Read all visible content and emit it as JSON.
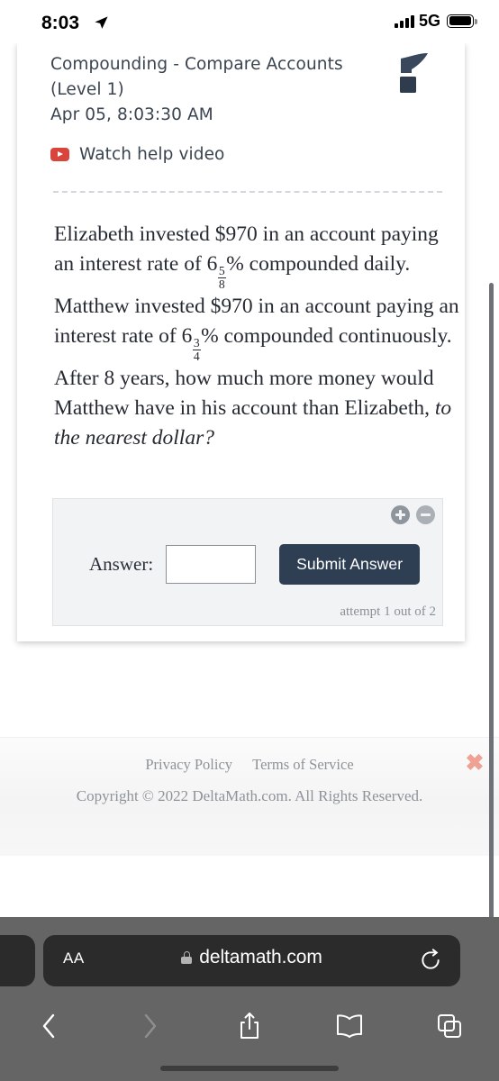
{
  "status_bar": {
    "time": "8:03",
    "location_icon": "location-arrow-icon",
    "signal_icon": "cellular-bars-icon",
    "network": "5G",
    "battery_icon": "battery-icon"
  },
  "assignment": {
    "title": "Compounding - Compare Accounts (Level 1)",
    "timestamp": "Apr 05, 8:03:30 AM",
    "help_video_label": "Watch help video",
    "help_video_icon": "youtube-play-icon",
    "logo_icon": "deltamath-logo-icon"
  },
  "question": {
    "part1": "Elizabeth invested $970 in an account paying an interest rate of 6",
    "frac1_num": "5",
    "frac1_den": "8",
    "part2": "% compounded daily. Matthew invested $970 in an account paying an interest rate of 6",
    "frac2_num": "3",
    "frac2_den": "4",
    "part3": "% compounded continuously. After 8 years, how much more money would Matthew have in his account than Elizabeth,",
    "part4_italic": "to the nearest dollar?"
  },
  "answer_panel": {
    "zoom_in_icon": "plus-circle-icon",
    "zoom_out_icon": "minus-circle-icon",
    "answer_label": "Answer:",
    "answer_value": "",
    "answer_placeholder": "",
    "submit_label": "Submit Answer",
    "attempt_text": "attempt 1 out of 2"
  },
  "footer": {
    "privacy_label": "Privacy Policy",
    "terms_label": "Terms of Service",
    "copyright": "Copyright © 2022 DeltaMath.com. All Rights Reserved.",
    "close_icon": "close-x-icon",
    "close_glyph": "✖"
  },
  "browser": {
    "text_size_label": "AA",
    "lock_icon": "lock-icon",
    "url": "deltamath.com",
    "reload_icon": "reload-icon",
    "back_icon": "chevron-left-icon",
    "forward_icon": "chevron-right-icon",
    "share_icon": "share-icon",
    "bookmarks_icon": "book-icon",
    "tabs_icon": "tabs-icon"
  },
  "colors": {
    "brand_navy": "#2e3f54",
    "youtube_red": "#d9453d",
    "close_salmon": "#efa193",
    "panel_gray": "#f2f3f4"
  }
}
